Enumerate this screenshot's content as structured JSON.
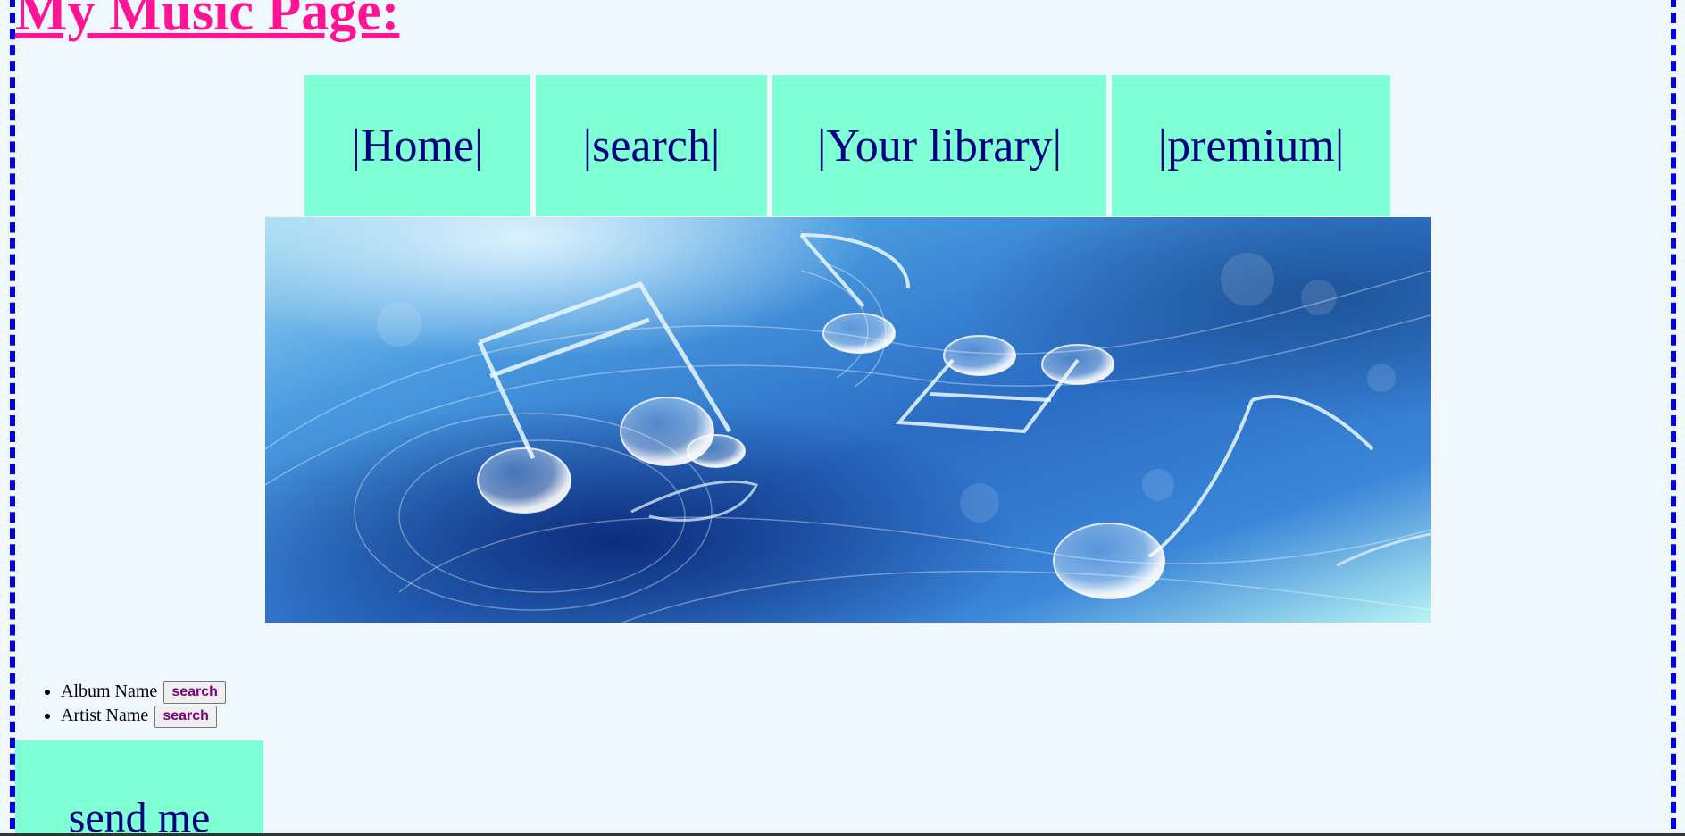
{
  "page": {
    "title": "My Music Page:"
  },
  "nav": {
    "items": [
      {
        "label": "|Home|"
      },
      {
        "label": "|search|"
      },
      {
        "label": "|Your library|"
      },
      {
        "label": "|premium|"
      }
    ]
  },
  "banner": {
    "description": "music-notes-banner"
  },
  "search": {
    "items": [
      {
        "label": "Album Name",
        "button": "search"
      },
      {
        "label": "Artist Name",
        "button": "search"
      }
    ]
  },
  "send": {
    "label": "send me"
  },
  "colors": {
    "background": "#f0f8ff",
    "title": "#ff1493",
    "nav_bg": "#7fffd4",
    "nav_text": "#000080",
    "frame_border": "#0000ee",
    "button_text": "#800080"
  }
}
